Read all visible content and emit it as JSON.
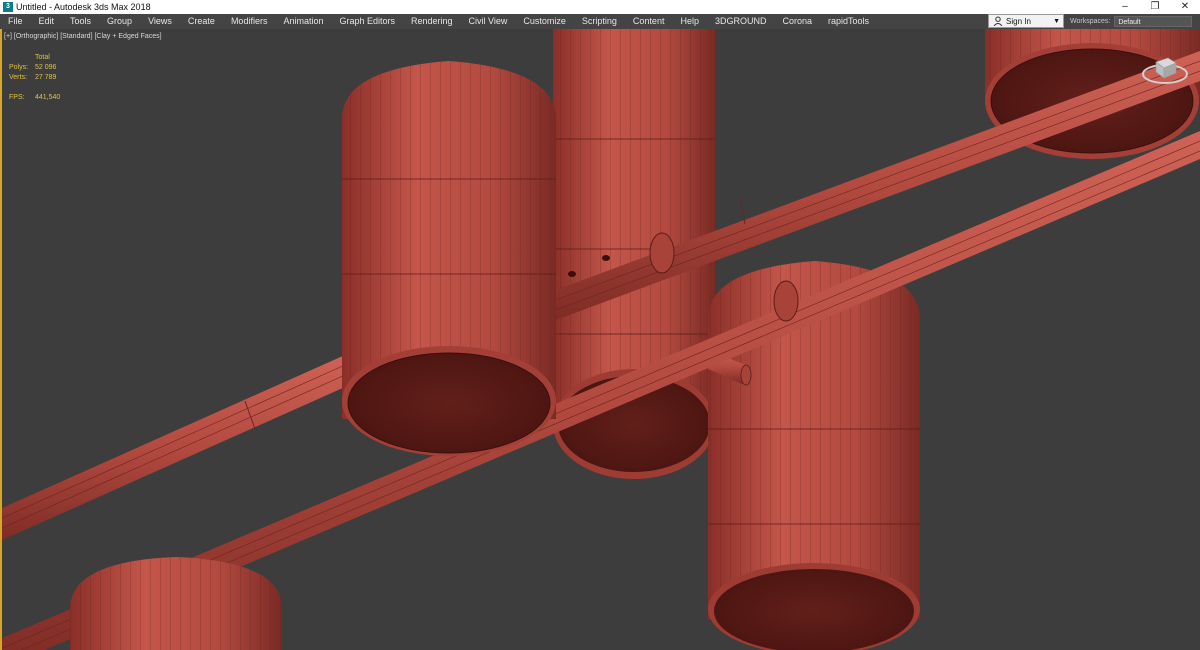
{
  "window": {
    "title": "Untitled - Autodesk 3ds Max 2018",
    "app_icon": "3ds-max-icon"
  },
  "menu": [
    "File",
    "Edit",
    "Tools",
    "Group",
    "Views",
    "Create",
    "Modifiers",
    "Animation",
    "Graph Editors",
    "Rendering",
    "Civil View",
    "Customize",
    "Scripting",
    "Content",
    "Help",
    "3DGROUND",
    "Corona",
    "rapidTools"
  ],
  "account": {
    "sign_in": "Sign In"
  },
  "workspaces": {
    "label": "Workspaces:",
    "value": "Default"
  },
  "viewport": {
    "label": "[+] [Orthographic] [Standard] [Clay + Edged Faces]",
    "stats": {
      "header": "Total",
      "polys_label": "Polys:",
      "polys": "52 096",
      "verts_label": "Verts:",
      "verts": "27 789",
      "fps_label": "FPS:",
      "fps": "441,540"
    }
  },
  "colors": {
    "clay": "#b8483f",
    "clay_dark": "#5b1b16",
    "background": "#3d3d3d",
    "stats_text": "#e2c33e",
    "active_border": "#d4a62a"
  }
}
